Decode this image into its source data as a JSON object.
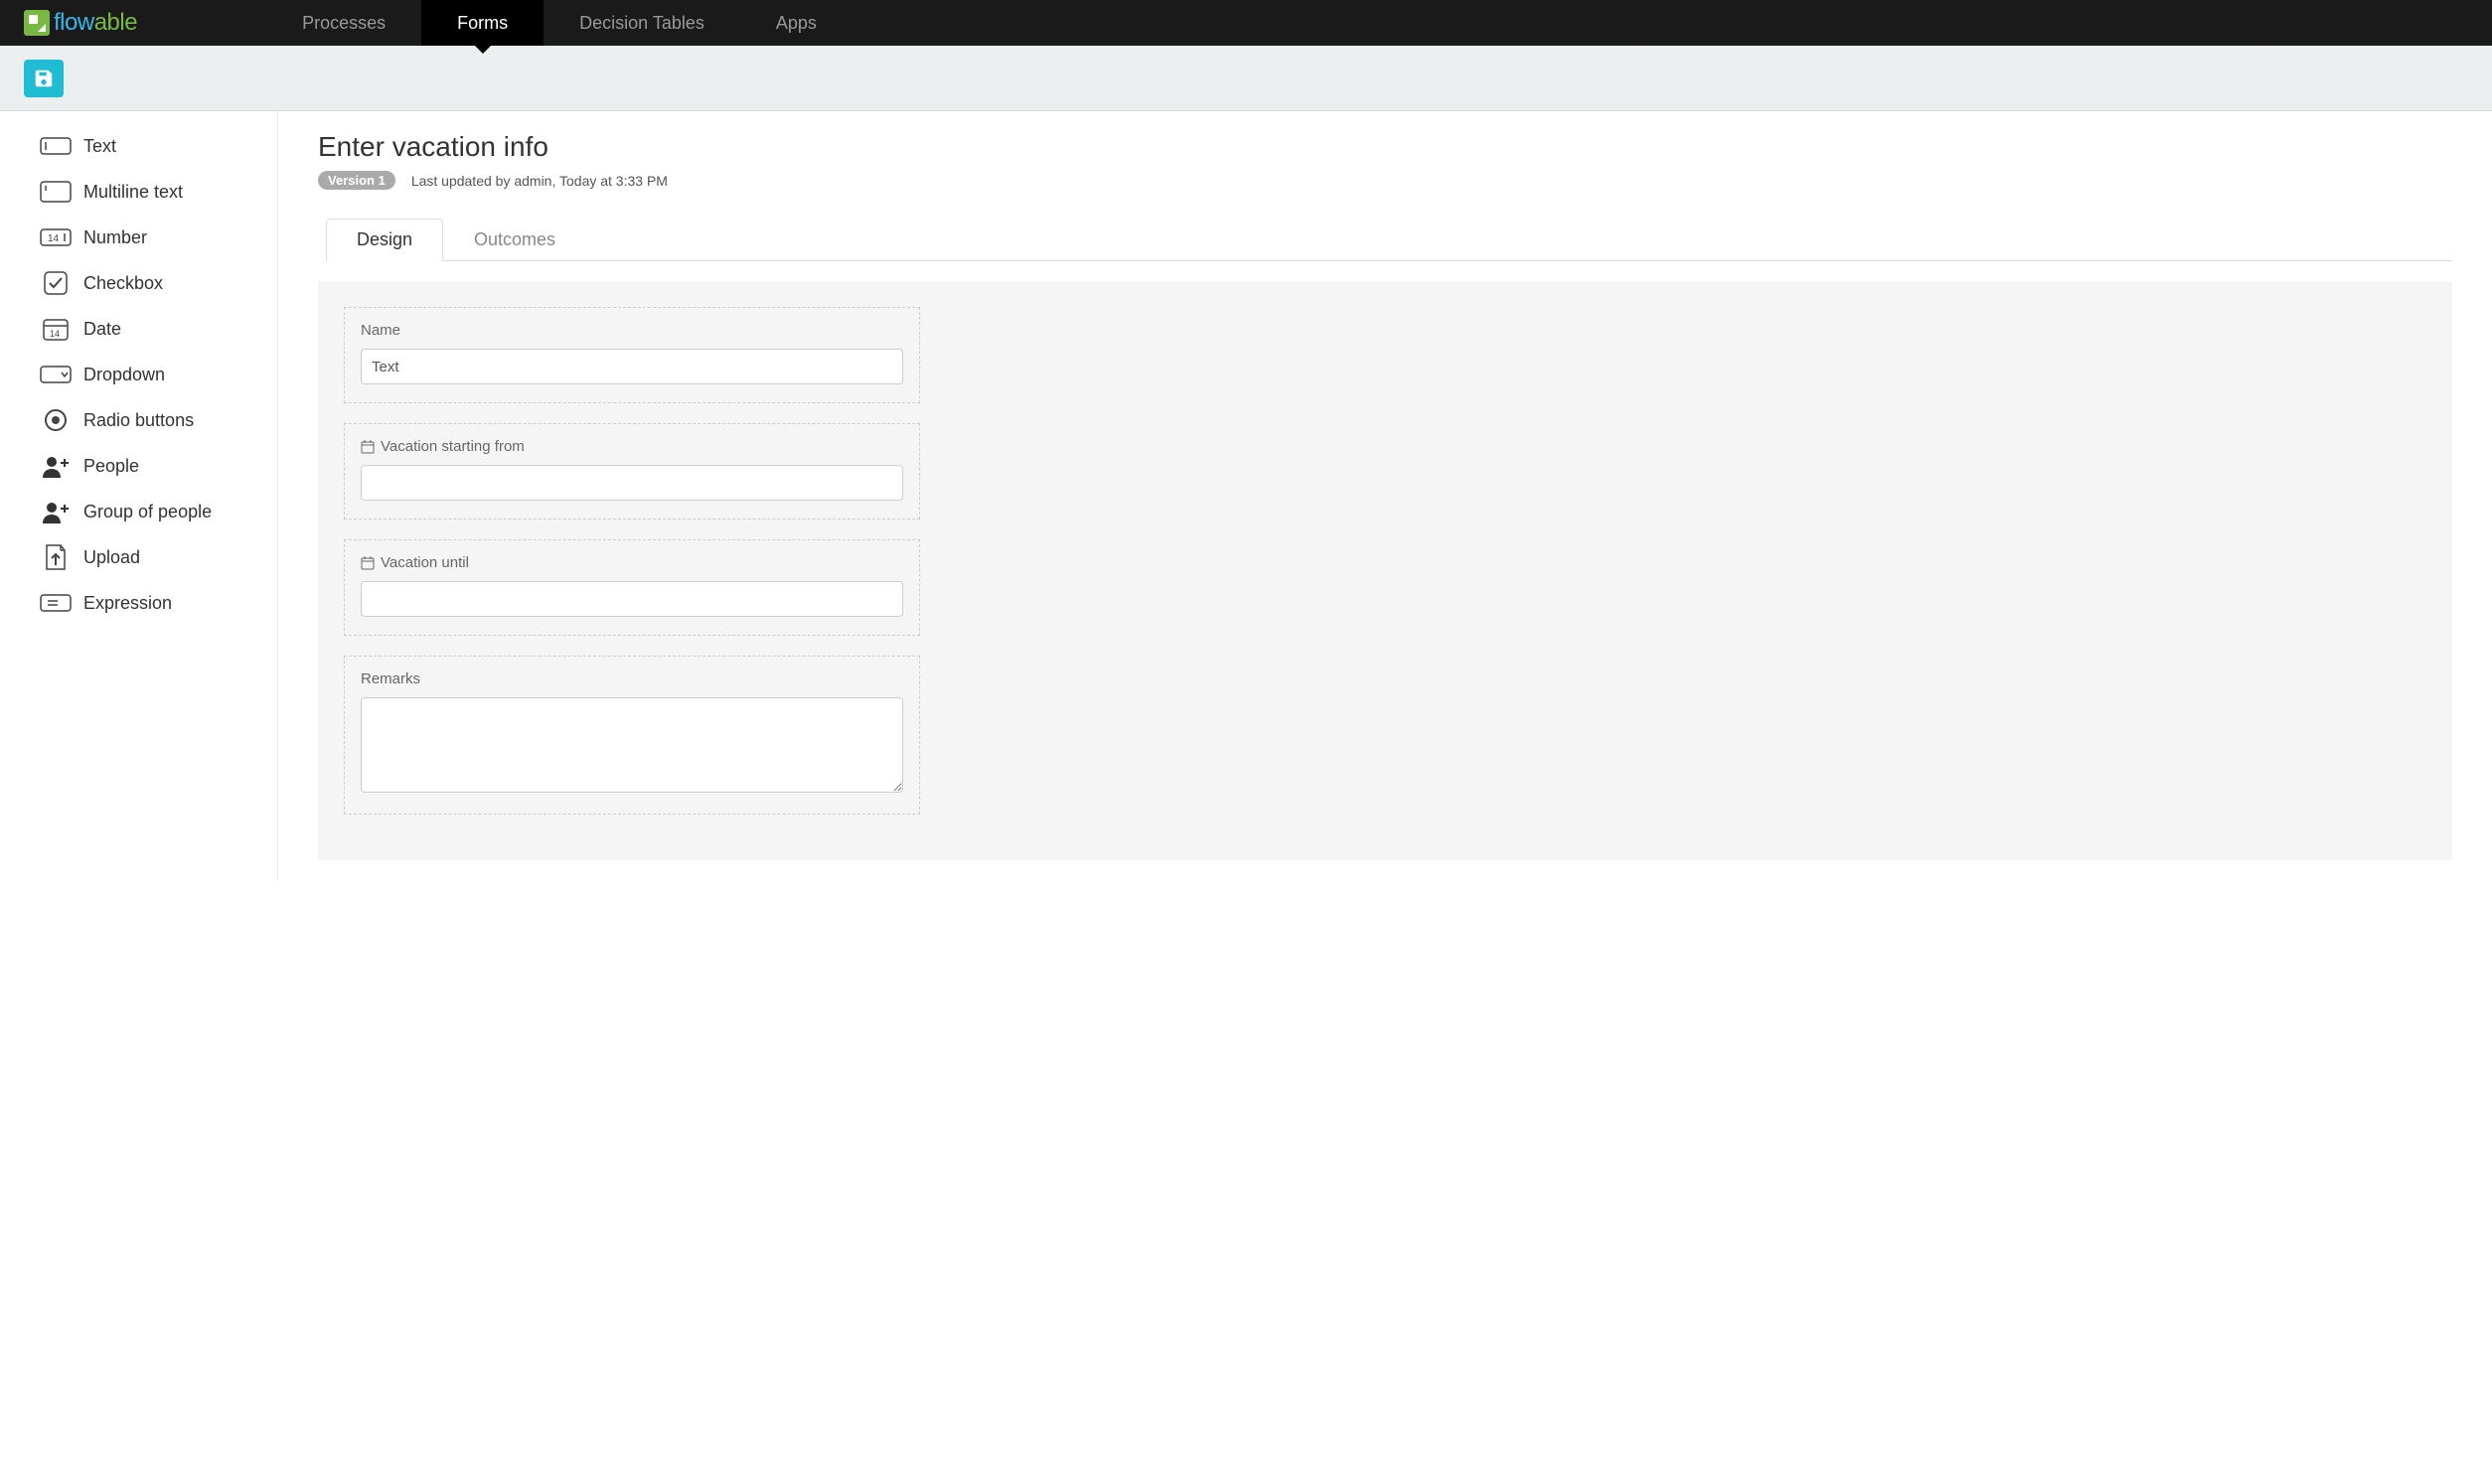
{
  "brand": {
    "part1": "flow",
    "part2": "able"
  },
  "nav": [
    {
      "label": "Processes",
      "active": false
    },
    {
      "label": "Forms",
      "active": true
    },
    {
      "label": "Decision Tables",
      "active": false
    },
    {
      "label": "Apps",
      "active": false
    }
  ],
  "page": {
    "title": "Enter vacation info",
    "version_label": "Version 1",
    "last_updated": "Last updated by admin, Today at 3:33 PM"
  },
  "tabs": [
    {
      "label": "Design",
      "active": true
    },
    {
      "label": "Outcomes",
      "active": false
    }
  ],
  "palette": [
    {
      "id": "text",
      "label": "Text"
    },
    {
      "id": "multiline",
      "label": "Multiline text"
    },
    {
      "id": "number",
      "label": "Number"
    },
    {
      "id": "checkbox",
      "label": "Checkbox"
    },
    {
      "id": "date",
      "label": "Date"
    },
    {
      "id": "dropdown",
      "label": "Dropdown"
    },
    {
      "id": "radio",
      "label": "Radio buttons"
    },
    {
      "id": "people",
      "label": "People"
    },
    {
      "id": "group",
      "label": "Group of people"
    },
    {
      "id": "upload",
      "label": "Upload"
    },
    {
      "id": "expression",
      "label": "Expression"
    }
  ],
  "form_fields": [
    {
      "type": "text",
      "label": "Name",
      "value": "Text",
      "has_date_icon": false
    },
    {
      "type": "date",
      "label": "Vacation starting from",
      "value": "",
      "has_date_icon": true
    },
    {
      "type": "date",
      "label": "Vacation until",
      "value": "",
      "has_date_icon": true
    },
    {
      "type": "multiline",
      "label": "Remarks",
      "value": "",
      "has_date_icon": false
    }
  ]
}
